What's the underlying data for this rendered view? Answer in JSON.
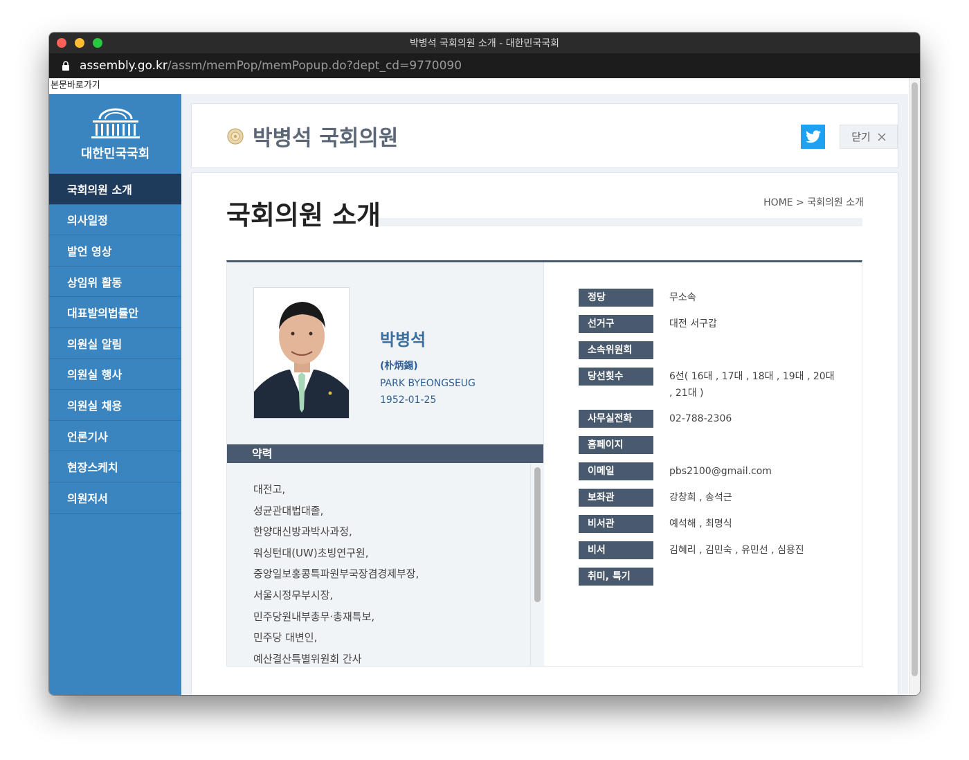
{
  "window": {
    "title": "박병석 국회의원 소개 - 대한민국국회",
    "url_host": "assembly.go.kr",
    "url_path": "/assm/memPop/memPopup.do?dept_cd=9770090"
  },
  "skip_link": "본문바로가기",
  "sidebar": {
    "logo_text": "대한민국국회",
    "items": [
      {
        "label": "국회의원 소개"
      },
      {
        "label": "의사일정"
      },
      {
        "label": "발언 영상"
      },
      {
        "label": "상임위 활동"
      },
      {
        "label": "대표발의법률안"
      },
      {
        "label": "의원실 알림"
      },
      {
        "label": "의원실 행사"
      },
      {
        "label": "의원실 채용"
      },
      {
        "label": "언론기사"
      },
      {
        "label": "현장스케치"
      },
      {
        "label": "의원저서"
      }
    ]
  },
  "header": {
    "title": "박병석 국회의원",
    "close_label": "닫기"
  },
  "main": {
    "page_title": "국회의원 소개",
    "breadcrumb": "HOME > 국회의원 소개"
  },
  "profile": {
    "name_ko": "박병석",
    "name_hanja": "(朴炳錫)",
    "name_en": "PARK BYEONGSEUG",
    "birth": "1952-01-25",
    "career_header": "약력",
    "career": [
      "대전고,",
      "성균관대법대졸,",
      "한양대신방과박사과정,",
      "워싱턴대(UW)초빙연구원,",
      "중앙일보홍콩특파원부국장겸경제부장,",
      "서울시정무부시장,",
      "민주당원내부총무·총재특보,",
      "민주당 대변인,",
      "예산결산특별위원회 간사"
    ],
    "info": [
      {
        "label": "정당",
        "value": "무소속"
      },
      {
        "label": "선거구",
        "value": "대전 서구갑"
      },
      {
        "label": "소속위원회",
        "value": ""
      },
      {
        "label": "당선횟수",
        "value": "6선( 16대 , 17대 , 18대 , 19대 , 20대 , 21대 )"
      },
      {
        "label": "사무실전화",
        "value": "02-788-2306"
      },
      {
        "label": "홈페이지",
        "value": ""
      },
      {
        "label": "이메일",
        "value": "pbs2100@gmail.com"
      },
      {
        "label": "보좌관",
        "value": "강창희 , 송석근"
      },
      {
        "label": "비서관",
        "value": "예석해 , 최명식"
      },
      {
        "label": "비서",
        "value": "김혜리 , 김민숙 , 유민선 , 심용진"
      },
      {
        "label": "취미, 특기",
        "value": ""
      }
    ]
  },
  "colors": {
    "sidebar": "#3a84c0",
    "sidebar_active": "#1f3b5c",
    "label_bg": "#4a5a6e",
    "twitter": "#1da1f2",
    "name_blue": "#3c6ea0"
  }
}
